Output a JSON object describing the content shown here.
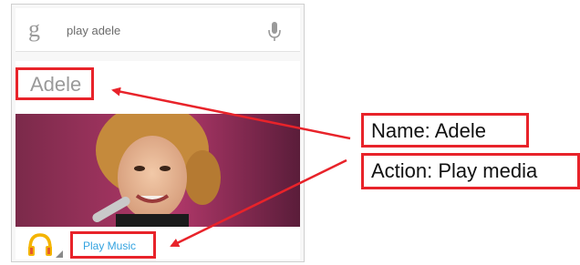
{
  "search": {
    "logo": "g",
    "query": "play adele",
    "icons": {
      "logo": "google-g-icon",
      "mic": "microphone-icon"
    }
  },
  "card": {
    "entity_name": "Adele",
    "action_label": "Play Music",
    "icons": {
      "app": "play-music-headphones-icon",
      "expand": "corner-triangle-icon"
    }
  },
  "annotations": {
    "name_label": "Name: Adele",
    "action_label": "Action: Play media"
  },
  "colors": {
    "callout": "#e8232a",
    "link": "#33a3e0",
    "headphones": "#f4b400"
  }
}
